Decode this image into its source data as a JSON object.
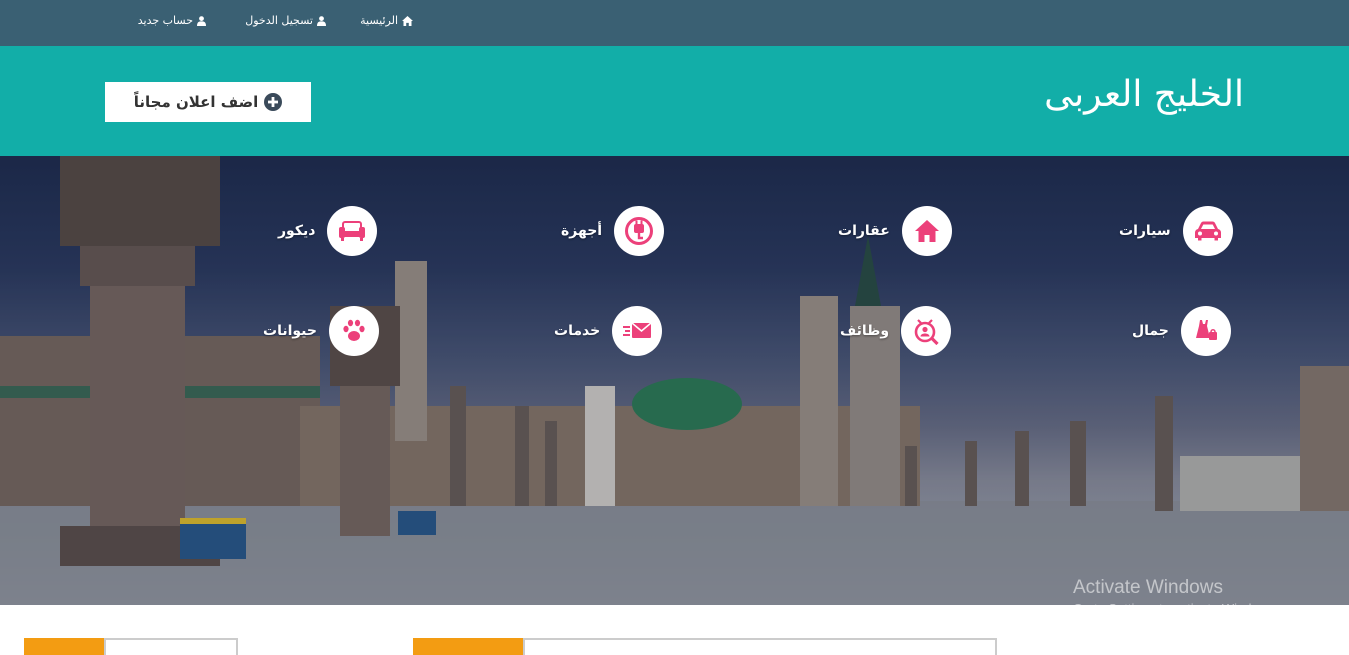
{
  "topnav": {
    "home": "الرئيسية",
    "login": "تسجيل الدخول",
    "register": "حساب جديد"
  },
  "header": {
    "title": "الخليج العربى",
    "add_button": "اضف اعلان مجاناً"
  },
  "categories": [
    {
      "label": "سيارات",
      "icon": "car-icon"
    },
    {
      "label": "عقارات",
      "icon": "house-icon"
    },
    {
      "label": "أجهزة",
      "icon": "plug-icon"
    },
    {
      "label": "ديكور",
      "icon": "sofa-icon"
    },
    {
      "label": "جمال",
      "icon": "dress-icon"
    },
    {
      "label": "وظائف",
      "icon": "job-search-icon"
    },
    {
      "label": "خدمات",
      "icon": "fast-mail-icon"
    },
    {
      "label": "حيوانات",
      "icon": "paw-icon"
    }
  ],
  "watermark": {
    "line1": "Activate Windows",
    "line2": "Go to Settings to activate Windows."
  },
  "colors": {
    "topbar": "#3a6073",
    "header": "#12aea8",
    "category_icon": "#ec407a",
    "tab_accent": "#f39c12"
  }
}
